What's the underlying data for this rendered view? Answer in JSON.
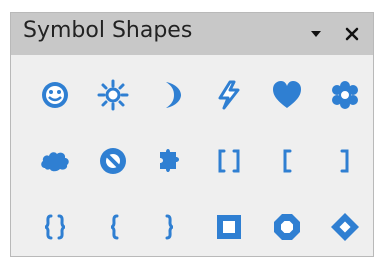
{
  "panel": {
    "title": "Symbol Shapes",
    "dropdown_icon": "triangle-down-icon",
    "close_icon": "close-icon"
  },
  "colors": {
    "titlebar_bg": "#c8c8c8",
    "panel_bg": "#efefef",
    "symbol_blue": "#2f7fd2"
  },
  "symbols": [
    [
      "smiley-face-icon",
      "sun-icon",
      "moon-icon",
      "lightning-bolt-icon",
      "heart-icon",
      "flower-icon"
    ],
    [
      "cloud-icon",
      "prohibited-symbol-icon",
      "puzzle-icon",
      "double-bracket-icon",
      "left-bracket-icon",
      "right-bracket-icon"
    ],
    [
      "double-brace-icon",
      "left-brace-icon",
      "right-brace-icon",
      "square-bevel-icon",
      "octagon-bevel-icon",
      "diamond-bevel-icon"
    ]
  ]
}
